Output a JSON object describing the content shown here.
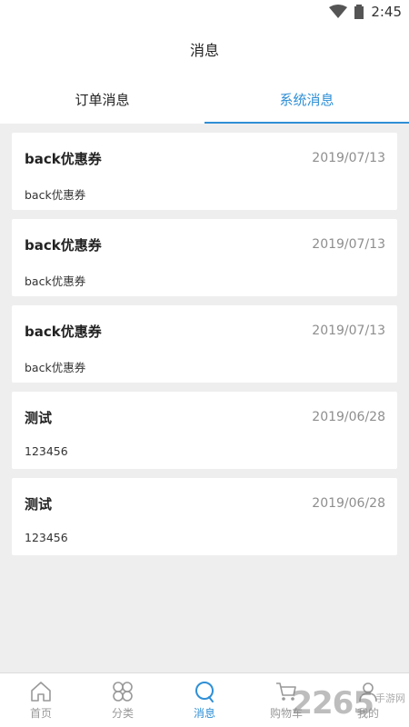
{
  "status_bar": {
    "time": "2:45"
  },
  "header": {
    "title": "消息"
  },
  "tabs": [
    {
      "label": "订单消息",
      "active": false
    },
    {
      "label": "系统消息",
      "active": true
    }
  ],
  "messages": [
    {
      "title": "back优惠券",
      "date": "2019/07/13",
      "body": "back优惠券"
    },
    {
      "title": "back优惠券",
      "date": "2019/07/13",
      "body": "back优惠券"
    },
    {
      "title": "back优惠券",
      "date": "2019/07/13",
      "body": "back优惠券"
    },
    {
      "title": "测试",
      "date": "2019/06/28",
      "body": "123456"
    },
    {
      "title": "测试",
      "date": "2019/06/28",
      "body": "123456"
    }
  ],
  "bottom_nav": [
    {
      "label": "首页",
      "icon": "home-icon",
      "active": false
    },
    {
      "label": "分类",
      "icon": "category-icon",
      "active": false
    },
    {
      "label": "消息",
      "icon": "message-icon",
      "active": true
    },
    {
      "label": "购物车",
      "icon": "cart-icon",
      "active": false
    },
    {
      "label": "我的",
      "icon": "profile-icon",
      "active": false
    }
  ],
  "watermark": {
    "logo": "2265",
    "text": "手游网"
  },
  "colors": {
    "accent": "#2f8fd6",
    "background": "#eeeeee",
    "date_gray": "#8e8e8e"
  }
}
